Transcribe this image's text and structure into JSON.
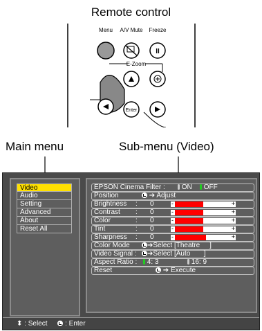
{
  "remote_title": "Remote control",
  "remote": {
    "menu_label": "Menu",
    "av_mute_label": "A/V Mute",
    "freeze_label": "Freeze",
    "ezoom_label": "E-Zoom",
    "enter_label": "Enter"
  },
  "labels": {
    "main_menu": "Main menu",
    "sub_menu": "Sub-menu (Video)"
  },
  "main_menu": {
    "items": [
      "Video",
      "Audio",
      "Setting",
      "Advanced",
      "About",
      "Reset All"
    ],
    "selected": "Video"
  },
  "sub_menu": {
    "cinema_filter": {
      "label": "EPSON Cinema Filter :",
      "on": "ON",
      "off": "OFF",
      "selected": "OFF"
    },
    "position": {
      "label": "Position",
      "action": "Adjust"
    },
    "sliders": [
      {
        "label": "Brightness",
        "value": "0",
        "level": 0.5
      },
      {
        "label": "Contrast",
        "value": "0",
        "level": 0.5
      },
      {
        "label": "Color",
        "value": "0",
        "level": 0.5
      },
      {
        "label": "Tint",
        "value": "0",
        "level": 0.5
      },
      {
        "label": "Sharpness",
        "value": "0",
        "level": 0.55
      }
    ],
    "color_mode": {
      "label": "Color Mode",
      "action": "Select",
      "value": "[Theatre     ]"
    },
    "video_signal": {
      "label": "Video Signal :",
      "action": "Select",
      "value": "[Auto       ]"
    },
    "aspect_ratio": {
      "label": "Aspect Ratio :",
      "opt1": "4: 3",
      "opt2": "16: 9",
      "selected": "4: 3"
    },
    "reset": {
      "label": "Reset",
      "action": "Execute"
    },
    "slider_minus": "-",
    "slider_plus": "+"
  },
  "status": {
    "select": ": Select",
    "enter": ": Enter"
  },
  "colors": {
    "selected_item": "#ffe000",
    "slider_fill": "#ff0000",
    "radio_selected": "#22cc22",
    "panel": "#5e5e5e"
  }
}
